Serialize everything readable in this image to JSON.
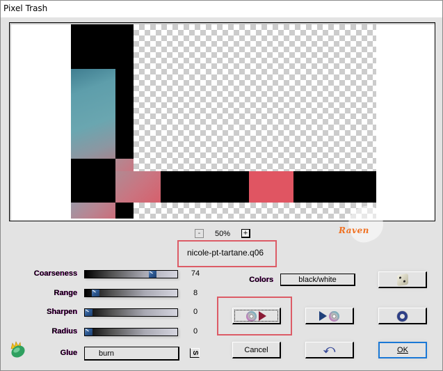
{
  "window": {
    "title": "Pixel Trash"
  },
  "preview": {
    "zoom_out_label": "-",
    "zoom_level": "50%",
    "zoom_in_label": "+",
    "preset_filename": "nicole-pt-tartane.q06"
  },
  "branding": {
    "logo_text": "Raven"
  },
  "controls": {
    "sliders": [
      {
        "label": "Coarseness",
        "value": "74",
        "fraction": 0.74
      },
      {
        "label": "Range",
        "value": "8",
        "fraction": 0.08
      },
      {
        "label": "Sharpen",
        "value": "0",
        "fraction": 0.0
      },
      {
        "label": "Radius",
        "value": "0",
        "fraction": 0.0
      }
    ],
    "glue": {
      "label": "Glue",
      "value": "burn",
      "s_button": "S"
    },
    "colors": {
      "label": "Colors",
      "value": "black/white"
    }
  },
  "buttons": {
    "load_preset_icon": "cd-play-icon",
    "save_preset_icon": "play-cd-icon",
    "randomize_icon": "dice-icon",
    "reset_icon": "ring-icon",
    "undo_icon": "undo-icon",
    "cancel": "Cancel",
    "ok": "OK"
  },
  "accent_colors": {
    "highlight": "#dc5b66",
    "ok_focus": "#1a78d6",
    "logo": "#f07020"
  }
}
